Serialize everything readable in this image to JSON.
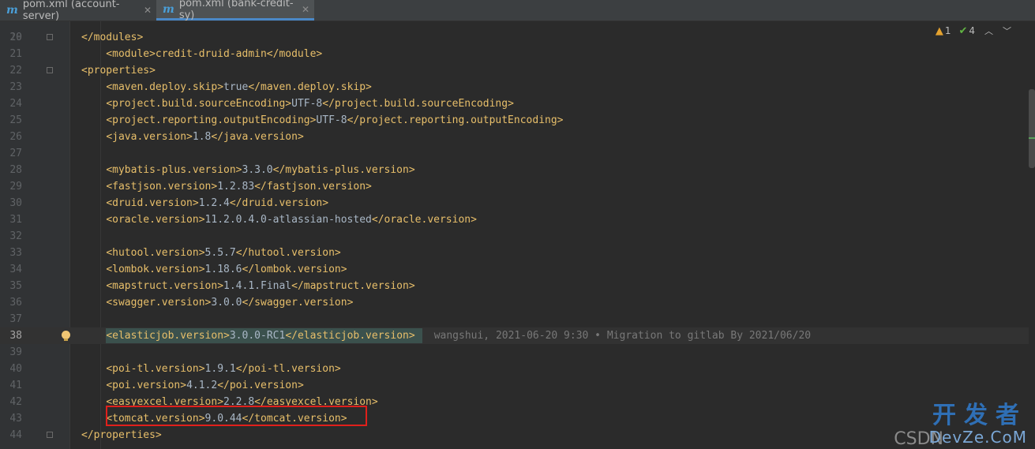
{
  "tabs": [
    {
      "label": "pom.xml (account-server)",
      "icon": "maven-icon",
      "active": false
    },
    {
      "label": "pom.xml (bank-credit-sy)",
      "icon": "maven-icon",
      "active": true
    }
  ],
  "inspections": {
    "warnings": "1",
    "ok": "4"
  },
  "lines": [
    {
      "num": "20",
      "indent": "",
      "tag": "</modules>",
      "value": "",
      "close": ""
    },
    {
      "num": "21",
      "indent": "",
      "tag": "",
      "value": "",
      "close": ""
    },
    {
      "num": "22",
      "indent": "",
      "tag": "<properties>",
      "value": "",
      "close": ""
    },
    {
      "num": "23",
      "indent": "    ",
      "tag": "<maven.deploy.skip>",
      "value": "true",
      "close": "</maven.deploy.skip>"
    },
    {
      "num": "24",
      "indent": "    ",
      "tag": "<project.build.sourceEncoding>",
      "value": "UTF-8",
      "close": "</project.build.sourceEncoding>"
    },
    {
      "num": "25",
      "indent": "    ",
      "tag": "<project.reporting.outputEncoding>",
      "value": "UTF-8",
      "close": "</project.reporting.outputEncoding>"
    },
    {
      "num": "26",
      "indent": "    ",
      "tag": "<java.version>",
      "value": "1.8",
      "close": "</java.version>"
    },
    {
      "num": "27",
      "indent": "",
      "tag": "",
      "value": "",
      "close": ""
    },
    {
      "num": "28",
      "indent": "    ",
      "tag": "<mybatis-plus.version>",
      "value": "3.3.0",
      "close": "</mybatis-plus.version>"
    },
    {
      "num": "29",
      "indent": "    ",
      "tag": "<fastjson.version>",
      "value": "1.2.83",
      "close": "</fastjson.version>"
    },
    {
      "num": "30",
      "indent": "    ",
      "tag": "<druid.version>",
      "value": "1.2.4",
      "close": "</druid.version>"
    },
    {
      "num": "31",
      "indent": "    ",
      "tag": "<oracle.version>",
      "value": "11.2.0.4.0-atlassian-hosted",
      "close": "</oracle.version>"
    },
    {
      "num": "32",
      "indent": "",
      "tag": "",
      "value": "",
      "close": ""
    },
    {
      "num": "33",
      "indent": "    ",
      "tag": "<hutool.version>",
      "value": "5.5.7",
      "close": "</hutool.version>"
    },
    {
      "num": "34",
      "indent": "    ",
      "tag": "<lombok.version>",
      "value": "1.18.6",
      "close": "</lombok.version>"
    },
    {
      "num": "35",
      "indent": "    ",
      "tag": "<mapstruct.version>",
      "value": "1.4.1.Final",
      "close": "</mapstruct.version>"
    },
    {
      "num": "36",
      "indent": "    ",
      "tag": "<swagger.version>",
      "value": "3.0.0",
      "close": "</swagger.version>"
    },
    {
      "num": "37",
      "indent": "",
      "tag": "",
      "value": "",
      "close": ""
    },
    {
      "num": "38",
      "indent": "    ",
      "tag": "<elasticjob.version>",
      "value": "3.0.0-RC1",
      "close": "</elasticjob.version>"
    },
    {
      "num": "39",
      "indent": "",
      "tag": "",
      "value": "",
      "close": ""
    },
    {
      "num": "40",
      "indent": "    ",
      "tag": "<poi-tl.version>",
      "value": "1.9.1",
      "close": "</poi-tl.version>"
    },
    {
      "num": "41",
      "indent": "    ",
      "tag": "<poi.version>",
      "value": "4.1.2",
      "close": "</poi.version>"
    },
    {
      "num": "42",
      "indent": "    ",
      "tag": "<easyexcel.version>",
      "value": "2.2.8",
      "close": "</easyexcel.version>"
    },
    {
      "num": "43",
      "indent": "    ",
      "tag": "<tomcat.version>",
      "value": "9.0.44",
      "close": "</tomcat.version>"
    },
    {
      "num": "44",
      "indent": "",
      "tag": "</properties>",
      "value": "",
      "close": ""
    }
  ],
  "blame": "wangshui, 2021-06-20 9:30 • Migration to gitlab By 2021/06/20",
  "watermark": {
    "cn": "开发者",
    "en": "DevZe.CoM",
    "csdn": "CSDN"
  },
  "colors": {
    "tag": "#e8bf6a",
    "text": "#a9b7c6",
    "background": "#2b2b2b",
    "highlight_box": "#e0201b"
  }
}
